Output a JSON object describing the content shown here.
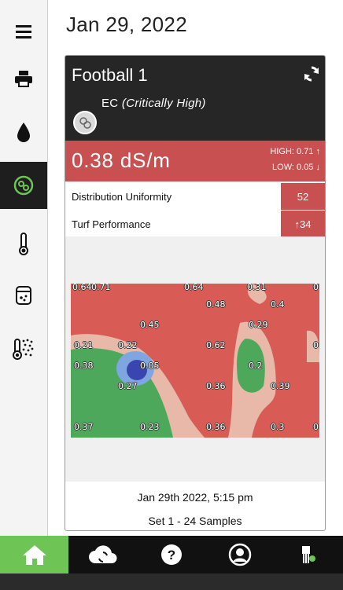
{
  "header": {
    "date": "Jan 29, 2022"
  },
  "sidebar": {
    "items": [
      {
        "icon": "menu-icon"
      },
      {
        "icon": "printer-icon"
      },
      {
        "icon": "water-drop-icon"
      },
      {
        "icon": "ec-sensor-icon",
        "active": true
      },
      {
        "icon": "thermometer-icon"
      },
      {
        "icon": "salinity-icon"
      },
      {
        "icon": "soil-temperature-icon"
      }
    ]
  },
  "card": {
    "title": "Football 1",
    "sensor": "EC",
    "status": "(Critically High)",
    "value": "0.38 dS/m",
    "high": "HIGH: 0.71",
    "low": "LOW: 0.05",
    "metrics": [
      {
        "label": "Distribution Uniformity",
        "value": "52"
      },
      {
        "label": "Turf Performance",
        "value": "34"
      }
    ],
    "map_points": [
      {
        "label": "0.64"
      },
      {
        "label": "0.71"
      },
      {
        "label": "0.64"
      },
      {
        "label": "0.31"
      },
      {
        "label": "0"
      },
      {
        "label": "0.48"
      },
      {
        "label": "0.4"
      },
      {
        "label": "0.45"
      },
      {
        "label": "0.29"
      },
      {
        "label": "0.21"
      },
      {
        "label": "0.22"
      },
      {
        "label": "0.62"
      },
      {
        "label": "0"
      },
      {
        "label": "0.38"
      },
      {
        "label": "0.05"
      },
      {
        "label": "0.2"
      },
      {
        "label": "0.27"
      },
      {
        "label": "0.36"
      },
      {
        "label": "0.39"
      },
      {
        "label": "0.37"
      },
      {
        "label": "0.23"
      },
      {
        "label": "0.36"
      },
      {
        "label": "0.3"
      },
      {
        "label": "0"
      }
    ],
    "footer_date": "Jan 29th 2022, 5:15 pm",
    "footer_set": "Set 1 - 24 Samples"
  },
  "colors": {
    "critical": "#c85050",
    "active_green": "#6ec455",
    "dark": "#262626"
  },
  "bottom_nav": [
    {
      "icon": "home-icon",
      "active": true
    },
    {
      "icon": "cloud-sync-icon"
    },
    {
      "icon": "help-icon"
    },
    {
      "icon": "account-icon"
    },
    {
      "icon": "device-status-icon"
    }
  ]
}
